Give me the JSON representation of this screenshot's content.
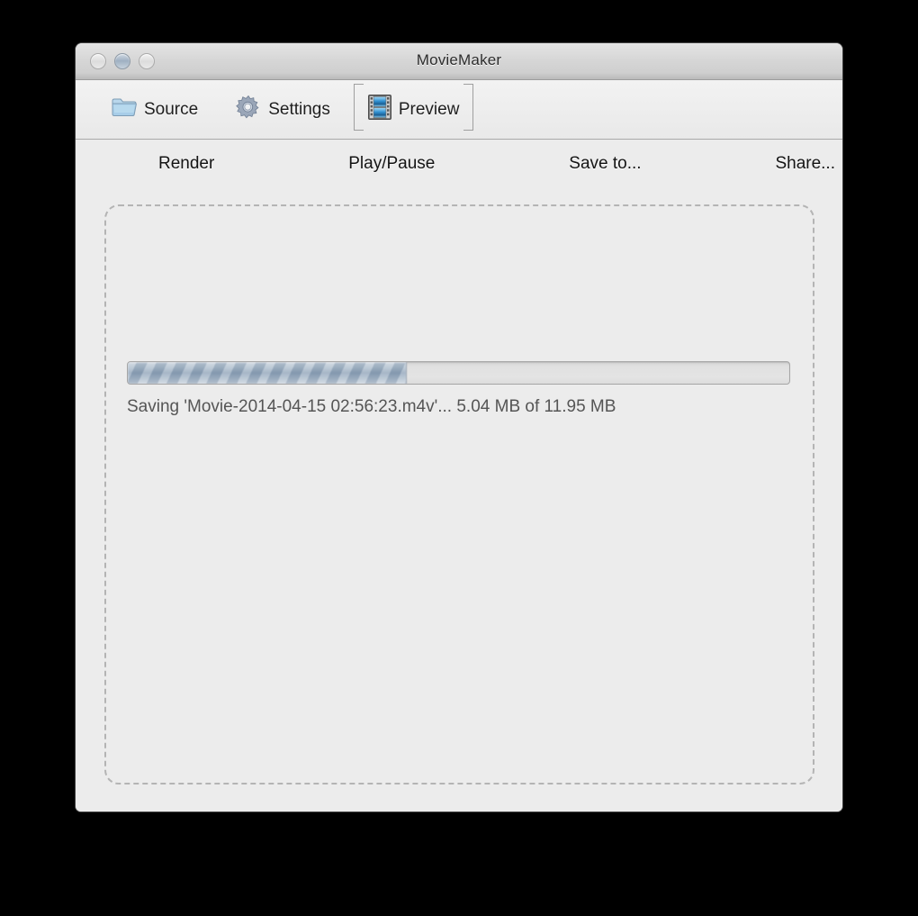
{
  "window": {
    "title": "MovieMaker",
    "controls": [
      {
        "name": "close",
        "label": "Close",
        "state": "inactive"
      },
      {
        "name": "minimize",
        "label": "Minimize",
        "state": "hover"
      },
      {
        "name": "zoom",
        "label": "Zoom",
        "state": "inactive"
      }
    ]
  },
  "toolbar": {
    "items": [
      {
        "id": "source",
        "label": "Source",
        "icon": "folder-icon",
        "selected": false
      },
      {
        "id": "settings",
        "label": "Settings",
        "icon": "gear-icon",
        "selected": false
      },
      {
        "id": "preview",
        "label": "Preview",
        "icon": "film-strip-icon",
        "selected": true
      }
    ]
  },
  "actions": {
    "buttons": [
      {
        "id": "render",
        "label": "Render"
      },
      {
        "id": "play-pause",
        "label": "Play/Pause"
      },
      {
        "id": "save-to",
        "label": "Save to..."
      },
      {
        "id": "share",
        "label": "Share..."
      }
    ]
  },
  "progress": {
    "percent": 42,
    "status": "Saving 'Movie-2014-04-15 02:56:23.m4v'... 5.04 MB of 11.95 MB",
    "filename": "Movie-2014-04-15 02:56:23.m4v",
    "transferred": "5.04 MB",
    "total": "11.95 MB"
  },
  "colors": {
    "window_background": "#ececec",
    "titlebar_top": "#e4e4e4",
    "titlebar_bottom": "#b9b9b9",
    "progress_fill": "#8ea2b8",
    "dashed_border": "#b4b4b4",
    "status_text": "#555555",
    "desktop": "#000000"
  }
}
